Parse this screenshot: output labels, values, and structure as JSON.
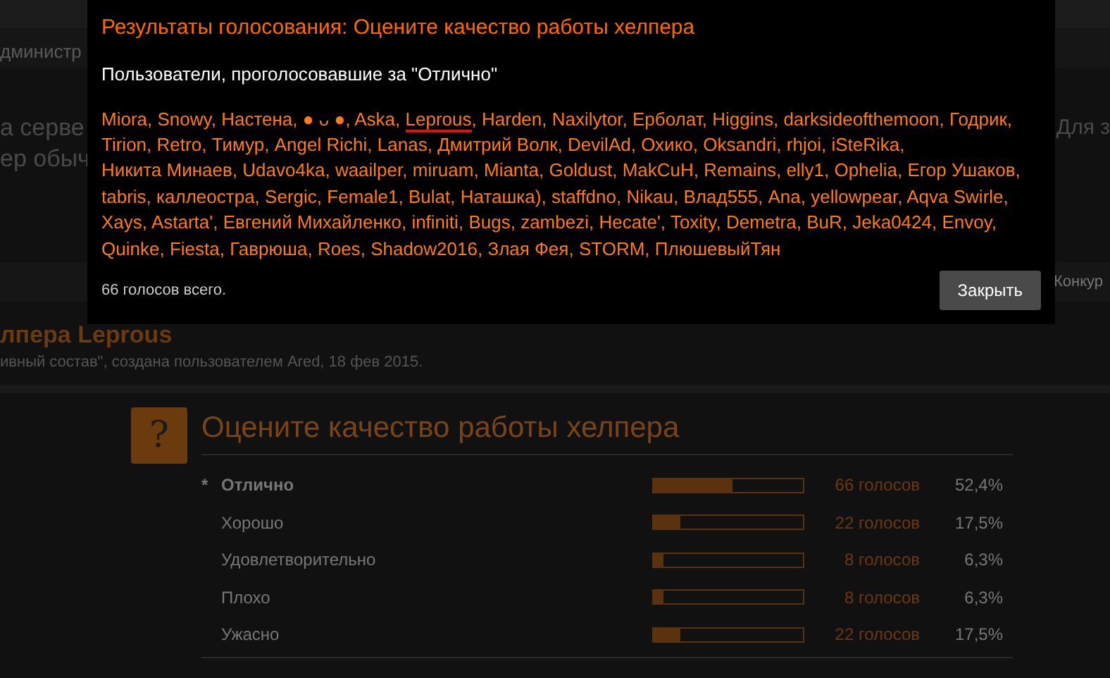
{
  "background": {
    "nav": [
      "дминистр"
    ],
    "notice": {
      "left_1": "а серве",
      "right_1": "Для з",
      "left_2": "ер обыч"
    },
    "tabs": [
      "Конкур"
    ],
    "thread": {
      "title": "лпера Leprous",
      "meta": "ивный состав\", создана пользователем Ared, 18 фев 2015."
    },
    "poll": {
      "icon_glyph": "?",
      "title": "Оцените качество работы хелпера",
      "voted_mark": "*",
      "options": [
        {
          "label": "Отлично",
          "selected": true,
          "level": 0.524,
          "votes": "66 голосов",
          "percent": "52,4%"
        },
        {
          "label": "Хорошо",
          "selected": false,
          "level": 0.175,
          "votes": "22 голосов",
          "percent": "17,5%"
        },
        {
          "label": "Удовлетворительно",
          "selected": false,
          "level": 0.063,
          "votes": "8 голосов",
          "percent": "6,3%"
        },
        {
          "label": "Плохо",
          "selected": false,
          "level": 0.063,
          "votes": "8 голосов",
          "percent": "6,3%"
        },
        {
          "label": "Ужасно",
          "selected": false,
          "level": 0.175,
          "votes": "22 голосов",
          "percent": "17,5%"
        }
      ]
    }
  },
  "dialog": {
    "title": "Результаты голосования: Оцените качество работы хелпера",
    "subtitle": "Пользователи, проголосовавшие за \"Отлично\"",
    "separator": ",",
    "voters": [
      {
        "name": "Miora",
        "underlined": false
      },
      {
        "name": "Snowy",
        "underlined": false
      },
      {
        "name": "Настена",
        "underlined": false
      },
      {
        "name": "● ᴗ ●",
        "underlined": false
      },
      {
        "name": "Aska",
        "underlined": false
      },
      {
        "name": "Leprous",
        "underlined": true
      },
      {
        "name": "Harden",
        "underlined": false
      },
      {
        "name": "Naxilytor",
        "underlined": false
      },
      {
        "name": "Ерболат",
        "underlined": false
      },
      {
        "name": "Higgins",
        "underlined": false
      },
      {
        "name": "darksideofthemoon",
        "underlined": false
      },
      {
        "name": "Годрик",
        "underlined": false
      },
      {
        "name": "Tirion",
        "underlined": false
      },
      {
        "name": "Retro",
        "underlined": false
      },
      {
        "name": "Тимур",
        "underlined": false
      },
      {
        "name": "Angel Richi",
        "underlined": false
      },
      {
        "name": "Lanas",
        "underlined": false
      },
      {
        "name": "Дмитрий Волк",
        "underlined": false
      },
      {
        "name": "DevilAd",
        "underlined": false
      },
      {
        "name": "Охико",
        "underlined": false
      },
      {
        "name": "Oksandri",
        "underlined": false
      },
      {
        "name": "rhjoi",
        "underlined": false
      },
      {
        "name": "iSteRika",
        "underlined": false
      },
      {
        "name": "Никита Минаев",
        "underlined": false
      },
      {
        "name": "Udavo4ka",
        "underlined": false
      },
      {
        "name": "waailper",
        "underlined": false
      },
      {
        "name": "miruam",
        "underlined": false
      },
      {
        "name": "Mianta",
        "underlined": false
      },
      {
        "name": "Goldust",
        "underlined": false
      },
      {
        "name": "MakCuH",
        "underlined": false
      },
      {
        "name": "Remains",
        "underlined": false
      },
      {
        "name": "elly1",
        "underlined": false
      },
      {
        "name": "Ophelia",
        "underlined": false
      },
      {
        "name": "Егор Ушаков",
        "underlined": false
      },
      {
        "name": "tabris",
        "underlined": false
      },
      {
        "name": "каллеостра",
        "underlined": false
      },
      {
        "name": "Sergic",
        "underlined": false
      },
      {
        "name": "Female1",
        "underlined": false
      },
      {
        "name": "Bulat",
        "underlined": false
      },
      {
        "name": "Наташка)",
        "underlined": false
      },
      {
        "name": "staffdno",
        "underlined": false
      },
      {
        "name": "Nikau",
        "underlined": false
      },
      {
        "name": "Влад555",
        "underlined": false
      },
      {
        "name": "Ana",
        "underlined": false
      },
      {
        "name": "yellowpear",
        "underlined": false
      },
      {
        "name": "Aqva Swirle",
        "underlined": false
      },
      {
        "name": "Xays",
        "underlined": false
      },
      {
        "name": "Astarta'",
        "underlined": false
      },
      {
        "name": "Евгений Михайленко",
        "underlined": false
      },
      {
        "name": "infiniti",
        "underlined": false
      },
      {
        "name": "Bugs",
        "underlined": false
      },
      {
        "name": "zambezi",
        "underlined": false
      },
      {
        "name": "Hecate'",
        "underlined": false
      },
      {
        "name": "Toxity",
        "underlined": false
      },
      {
        "name": "Demetra",
        "underlined": false
      },
      {
        "name": "BuR",
        "underlined": false
      },
      {
        "name": "Jeka0424",
        "underlined": false
      },
      {
        "name": "Envoy",
        "underlined": false
      },
      {
        "name": "Quinke",
        "underlined": false
      },
      {
        "name": "Fiesta",
        "underlined": false
      },
      {
        "name": "Гаврюша",
        "underlined": false
      },
      {
        "name": "Roes",
        "underlined": false
      },
      {
        "name": "Shadow2016",
        "underlined": false
      },
      {
        "name": "Злая Фея",
        "underlined": false
      },
      {
        "name": "STORM",
        "underlined": false
      },
      {
        "name": "ПлюшевыйТян",
        "underlined": false
      }
    ],
    "total": "66 голосов всего.",
    "close_button": "Закрыть"
  }
}
